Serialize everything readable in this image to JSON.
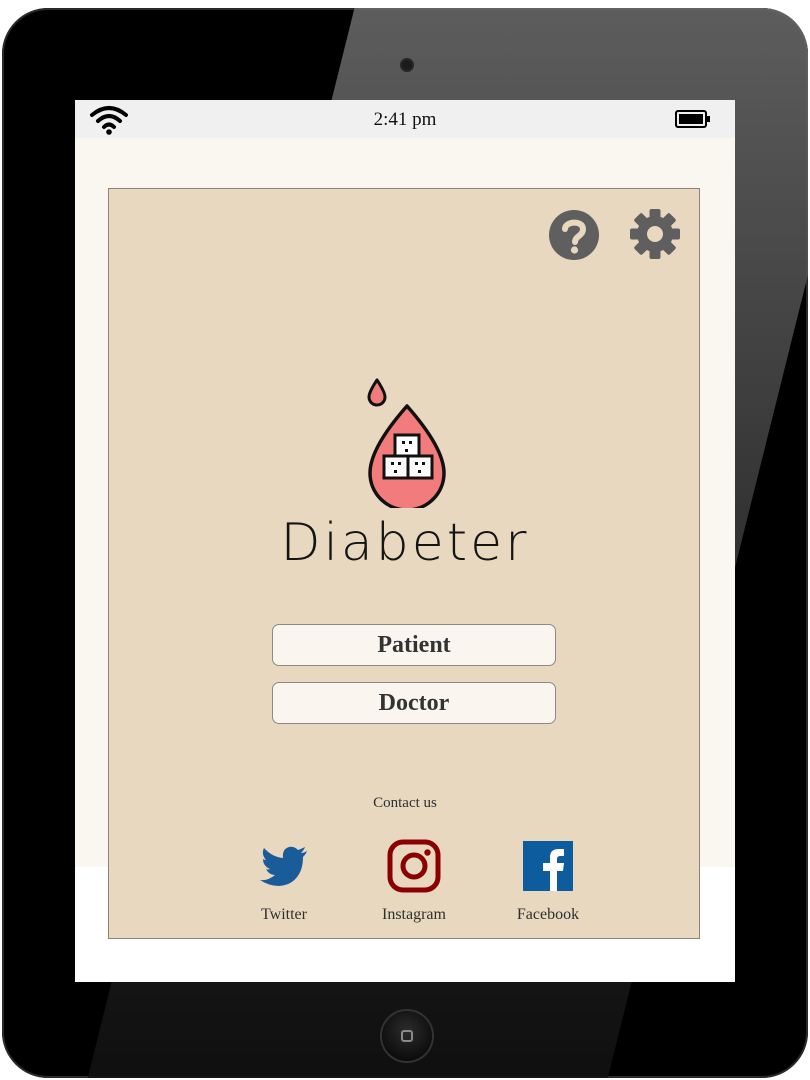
{
  "status_bar": {
    "time": "2:41 pm"
  },
  "app": {
    "brand_name": "Diabeter",
    "buttons": {
      "patient": "Patient",
      "doctor": "Doctor"
    },
    "contact_label": "Contact us",
    "social": [
      {
        "label": "Twitter",
        "icon": "twitter-icon",
        "color": "#1a5b99"
      },
      {
        "label": "Instagram",
        "icon": "instagram-icon",
        "color": "#8b0000"
      },
      {
        "label": "Facebook",
        "icon": "facebook-icon",
        "color": "#0d5c9e"
      }
    ]
  },
  "colors": {
    "panel_background": "#e8d8c0",
    "button_background": "#faf6ef",
    "toolbar_icon": "#5f5f5f",
    "logo_drop": "#f27c7c"
  }
}
